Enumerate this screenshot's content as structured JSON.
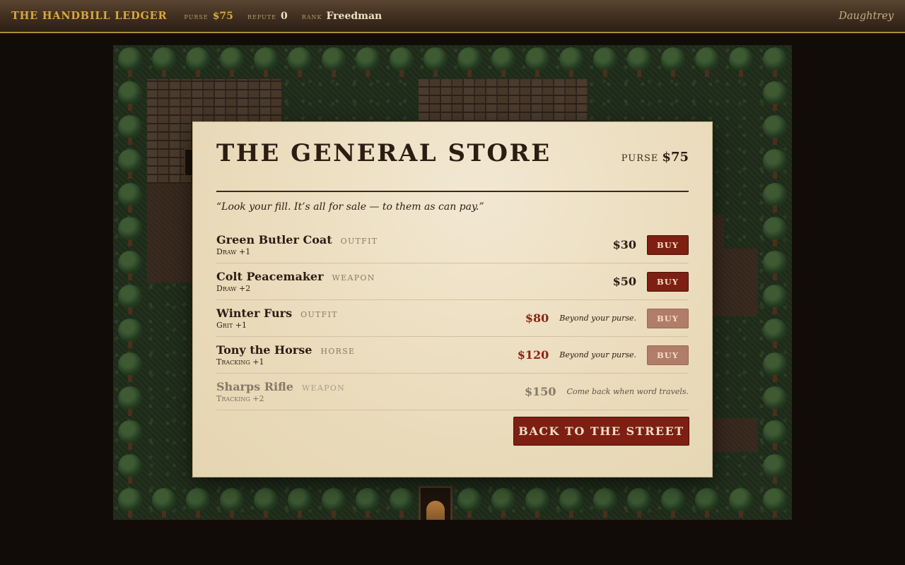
{
  "hud": {
    "title": "THE HANDBILL LEDGER",
    "purse_label": "purse",
    "purse_value": "$75",
    "repute_label": "repute",
    "repute_value": "0",
    "rank_label": "rank",
    "rank_value": "Freedman",
    "player_name": "Daughtrey"
  },
  "store": {
    "title": "THE GENERAL STORE",
    "purse_label": "PURSE",
    "purse_value": "$75",
    "quote": "“Look your fill. It’s all for sale — to them as can pay.”",
    "items": [
      {
        "name": "Green Butler Coat",
        "category": "OUTFIT",
        "bonus": "Draw +1",
        "price": "$30",
        "note": "",
        "buy_label": "BUY",
        "state": "affordable"
      },
      {
        "name": "Colt Peacemaker",
        "category": "WEAPON",
        "bonus": "Draw +2",
        "price": "$50",
        "note": "",
        "buy_label": "BUY",
        "state": "affordable"
      },
      {
        "name": "Winter Furs",
        "category": "OUTFIT",
        "bonus": "Grit +1",
        "price": "$80",
        "note": "Beyond your purse.",
        "buy_label": "BUY",
        "state": "too-expensive"
      },
      {
        "name": "Tony the Horse",
        "category": "HORSE",
        "bonus": "Tracking +1",
        "price": "$120",
        "note": "Beyond your purse.",
        "buy_label": "BUY",
        "state": "too-expensive"
      },
      {
        "name": "Sharps Rifle",
        "category": "WEAPON",
        "bonus": "Tracking +2",
        "price": "$150",
        "note": "Come back when word travels.",
        "buy_label": "",
        "state": "locked"
      }
    ],
    "back_label": "BACK TO THE STREET"
  },
  "colors": {
    "accent_gold": "#d9a93f",
    "button_red": "#7e1f13",
    "button_disabled": "#b27d68",
    "price_unaffordable": "#8a2416",
    "parchment": "#eadcbc"
  }
}
